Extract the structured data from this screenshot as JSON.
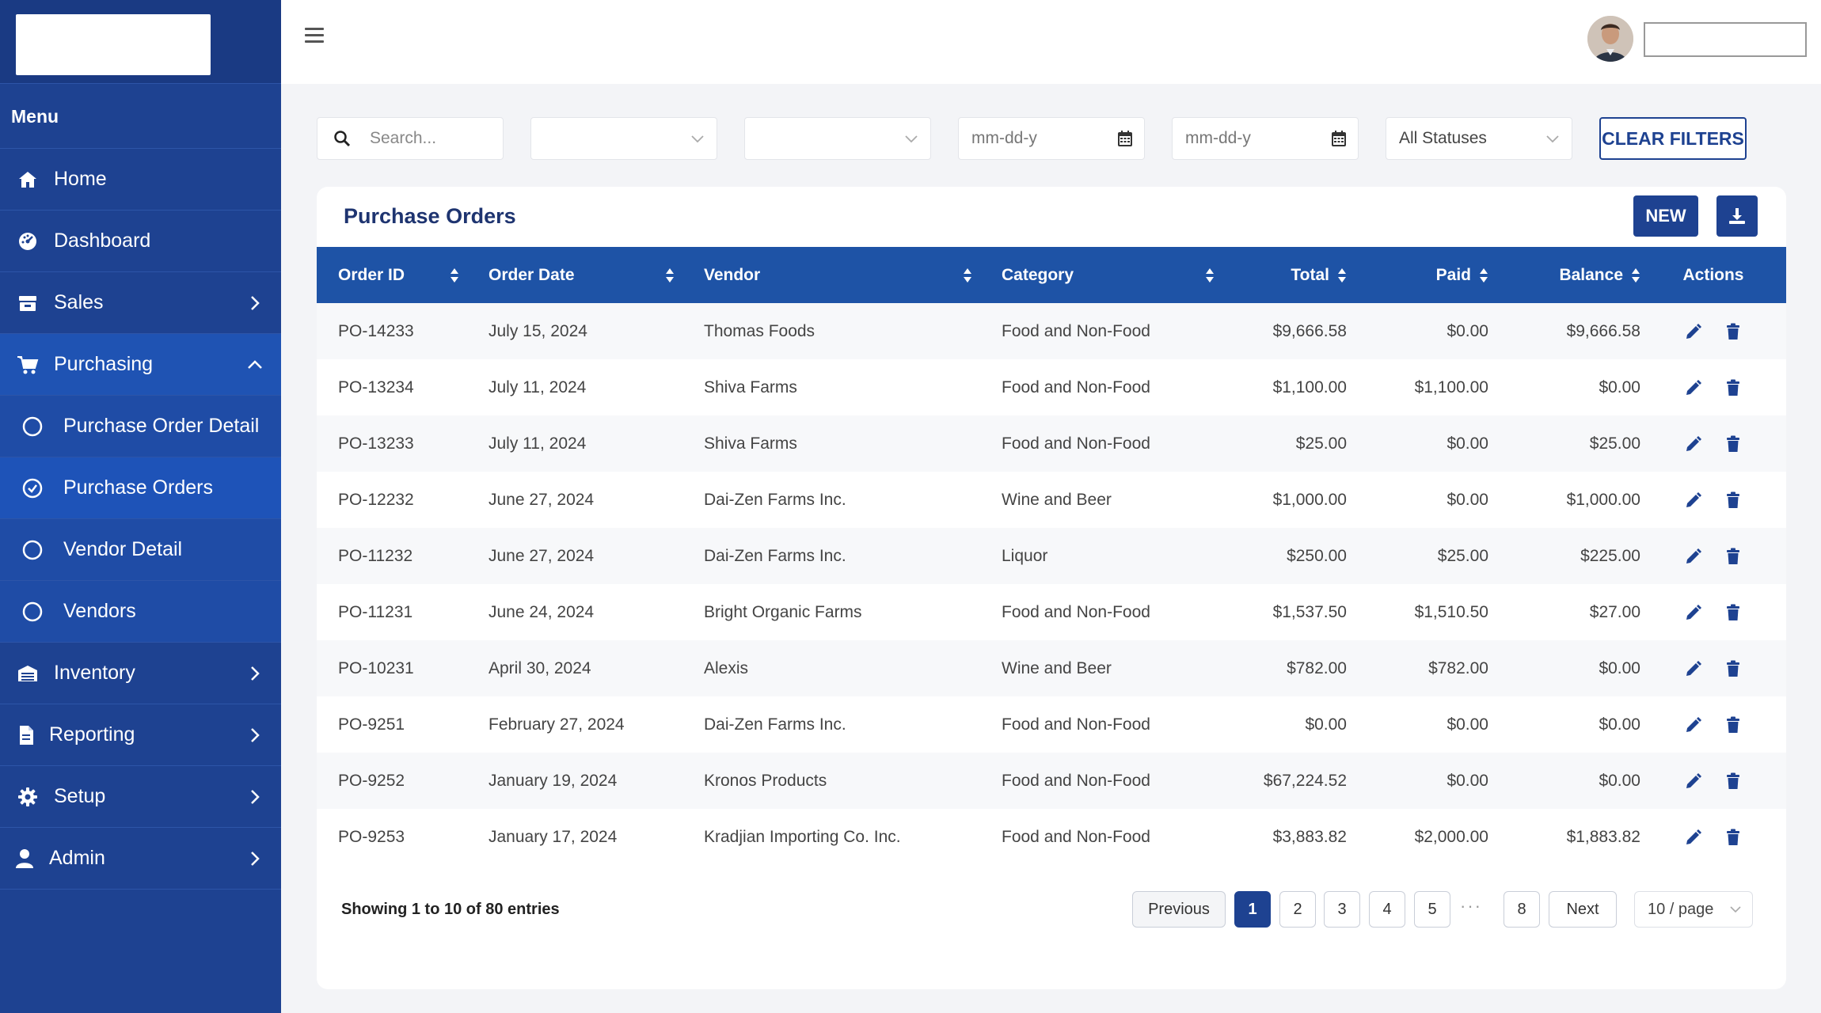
{
  "sidebar": {
    "menu_heading": "Menu",
    "items": [
      {
        "label": "Home",
        "icon": "home-icon"
      },
      {
        "label": "Dashboard",
        "icon": "dashboard-icon"
      },
      {
        "label": "Sales",
        "icon": "sales-icon"
      },
      {
        "label": "Purchasing",
        "icon": "cart-icon"
      },
      {
        "label": "Inventory",
        "icon": "inventory-icon"
      },
      {
        "label": "Reporting",
        "icon": "report-icon"
      },
      {
        "label": "Setup",
        "icon": "gear-icon"
      },
      {
        "label": "Admin",
        "icon": "user-icon"
      }
    ],
    "purchasing_sub": [
      {
        "label": "Purchase Order Detail"
      },
      {
        "label": "Purchase Orders"
      },
      {
        "label": "Vendor Detail"
      },
      {
        "label": "Vendors"
      }
    ]
  },
  "filters": {
    "search_placeholder": "Search...",
    "date_from_placeholder": "mm-dd-y",
    "date_to_placeholder": "mm-dd-y",
    "status_selected": "All Statuses",
    "clear_label": "CLEAR FILTERS"
  },
  "card": {
    "title": "Purchase Orders",
    "new_label": "NEW"
  },
  "table": {
    "headers": {
      "order_id": "Order ID",
      "order_date": "Order Date",
      "vendor": "Vendor",
      "category": "Category",
      "total": "Total",
      "paid": "Paid",
      "balance": "Balance",
      "actions": "Actions"
    },
    "rows": [
      {
        "id": "PO-14233",
        "date": "July 15, 2024",
        "vendor": "Thomas Foods",
        "category": "Food and Non-Food",
        "total": "$9,666.58",
        "paid": "$0.00",
        "balance": "$9,666.58"
      },
      {
        "id": "PO-13234",
        "date": "July 11, 2024",
        "vendor": "Shiva Farms",
        "category": "Food and Non-Food",
        "total": "$1,100.00",
        "paid": "$1,100.00",
        "balance": "$0.00"
      },
      {
        "id": "PO-13233",
        "date": "July 11, 2024",
        "vendor": "Shiva Farms",
        "category": "Food and Non-Food",
        "total": "$25.00",
        "paid": "$0.00",
        "balance": "$25.00"
      },
      {
        "id": "PO-12232",
        "date": "June 27, 2024",
        "vendor": "Dai-Zen Farms Inc.",
        "category": "Wine and Beer",
        "total": "$1,000.00",
        "paid": "$0.00",
        "balance": "$1,000.00"
      },
      {
        "id": "PO-11232",
        "date": "June 27, 2024",
        "vendor": "Dai-Zen Farms Inc.",
        "category": "Liquor",
        "total": "$250.00",
        "paid": "$25.00",
        "balance": "$225.00"
      },
      {
        "id": "PO-11231",
        "date": "June 24, 2024",
        "vendor": "Bright Organic Farms",
        "category": "Food and Non-Food",
        "total": "$1,537.50",
        "paid": "$1,510.50",
        "balance": "$27.00"
      },
      {
        "id": "PO-10231",
        "date": "April 30, 2024",
        "vendor": "Alexis",
        "category": "Wine and Beer",
        "total": "$782.00",
        "paid": "$782.00",
        "balance": "$0.00"
      },
      {
        "id": "PO-9251",
        "date": "February 27, 2024",
        "vendor": "Dai-Zen Farms Inc.",
        "category": "Food and Non-Food",
        "total": "$0.00",
        "paid": "$0.00",
        "balance": "$0.00"
      },
      {
        "id": "PO-9252",
        "date": "January 19, 2024",
        "vendor": "Kronos Products",
        "category": "Food and Non-Food",
        "total": "$67,224.52",
        "paid": "$0.00",
        "balance": "$0.00"
      },
      {
        "id": "PO-9253",
        "date": "January 17, 2024",
        "vendor": "Kradjian Importing Co. Inc.",
        "category": "Food and Non-Food",
        "total": "$3,883.82",
        "paid": "$2,000.00",
        "balance": "$1,883.82"
      }
    ]
  },
  "pagination": {
    "showing_text": "Showing 1 to 10 of 80 entries",
    "previous_label": "Previous",
    "next_label": "Next",
    "pages": [
      "1",
      "2",
      "3",
      "4",
      "5",
      "8"
    ],
    "ellipsis": "···",
    "per_page": "10 / page"
  },
  "colors": {
    "sidebar_bg": "#1e4291",
    "accent": "#1e4291",
    "table_header": "#1e53a6"
  }
}
